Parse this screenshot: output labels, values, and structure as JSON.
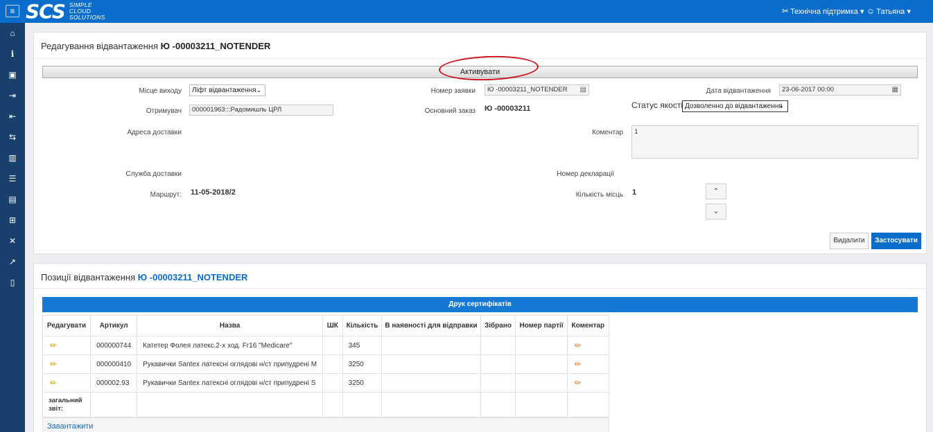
{
  "header": {
    "menu_icon": "hamburger-icon",
    "logo_mark": "SCS",
    "logo_line1": "SIMPLE",
    "logo_line2": "CLOUD",
    "logo_line3": "SOLUTIONS",
    "support_label": "Технічна підтримка",
    "user_label": "Татьяна"
  },
  "sidebar": {
    "icons": [
      "home-icon",
      "info-icon",
      "box-icon",
      "login-icon",
      "logout-icon",
      "shipping-icon",
      "chart-icon",
      "list-icon",
      "archive-icon",
      "warehouse-icon",
      "tools-icon",
      "report-icon",
      "mobile-icon"
    ]
  },
  "edit_panel": {
    "title_prefix": "Редагування відвантаження",
    "title_code": "Ю -00003211_NOTENDER",
    "activate_label": "Активувати",
    "fields": {
      "exit_place_label": "Місце виходу",
      "exit_place_value": "Ліфт відвантаження",
      "recipient_label": "Отримувач",
      "recipient_value": "000001963:::Радомишль ЦРЛ",
      "delivery_address_label": "Адреса доставки",
      "delivery_service_label": "Служба доставки",
      "route_label": "Маршрут:",
      "route_value": "11-05-2018/2",
      "request_number_label": "Номер заявки",
      "request_number_value": "Ю -00003211_NOTENDER",
      "main_order_label": "Основний заказ",
      "main_order_value": "Ю -00003211",
      "comment_label": "Коментар",
      "comment_value": "1",
      "declaration_label": "Номер декларації",
      "places_label": "Кількість місць",
      "places_value": "1",
      "ship_date_label": "Дата відвантаження",
      "ship_date_value": "23-06-2017 00:00",
      "quality_status_label": "Статус якості -",
      "quality_status_value": "Дозволенно до відвантаження"
    },
    "delete_label": "Видалити",
    "apply_label": "Застосувати"
  },
  "items_panel": {
    "title_prefix": "Позиції відвантаження",
    "title_code": "Ю -00003211_NOTENDER",
    "print_label": "Друк сертифікатів",
    "columns": [
      "Редагувати",
      "Артикул",
      "Назва",
      "ШК",
      "Кількість",
      "В наявності для відправки",
      "Зібрано",
      "Номер партії",
      "Коментар"
    ],
    "rows": [
      {
        "article": "000000744",
        "name": "Катетер Фолея латекс.2-х ход. Fr16 \"Medicare\"",
        "barcode": "",
        "qty": "345",
        "available": "",
        "collected": "",
        "batch": ""
      },
      {
        "article": "000000410",
        "name": "Рукавички Santex латексні оглядові н/ст припудрені M",
        "barcode": "",
        "qty": "3250",
        "available": "",
        "collected": "",
        "batch": ""
      },
      {
        "article": "000002.93",
        "name": "Рукавички Santex латексні оглядові н/ст припудрені S",
        "barcode": "",
        "qty": "3250",
        "available": "",
        "collected": "",
        "batch": ""
      }
    ],
    "total_label": "загальний звіт:",
    "download_label": "Завантажити"
  }
}
